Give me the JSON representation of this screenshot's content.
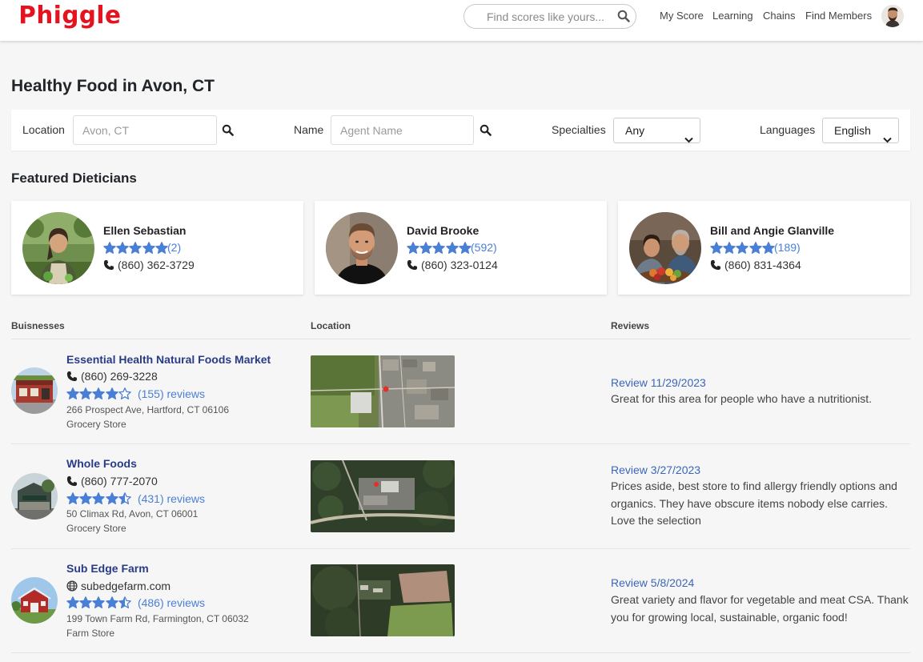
{
  "header": {
    "logo": "Phiggle",
    "search_placeholder": "Find scores like yours...",
    "nav": [
      "My Score",
      "Learning",
      "Chains",
      "Find Members"
    ]
  },
  "page_title": "Healthy Food in Avon, CT",
  "filters": {
    "location_label": "Location",
    "location_placeholder": "Avon, CT",
    "name_label": "Name",
    "name_placeholder": "Agent Name",
    "specialties_label": "Specialties",
    "specialties_value": "Any",
    "languages_label": "Languages",
    "languages_value": "English"
  },
  "featured_title": "Featured Dieticians",
  "featured": [
    {
      "name": "Ellen Sebastian",
      "rating": 5,
      "count": "(2)",
      "phone": "(860) 362-3729"
    },
    {
      "name": "David Brooke",
      "rating": 5,
      "count": "(592)",
      "phone": "(860) 323-0124"
    },
    {
      "name": "Bill and Angie Glanville",
      "rating": 5,
      "count": "(189)",
      "phone": "(860) 831-4364"
    }
  ],
  "table_headers": {
    "businesses": "Buisnesses",
    "location": "Location",
    "reviews": "Reviews"
  },
  "businesses": [
    {
      "name": "Essential Health Natural Foods Market",
      "contact_icon": "phone-icon",
      "contact": "(860) 269-3228",
      "rating": 4,
      "reviews": "(155) reviews",
      "address": "266 Prospect Ave, Hartford, CT 06106",
      "category": "Grocery Store",
      "review_date": "Review 11/29/2023",
      "review_text": "Great for this area for people who have a nutritionist."
    },
    {
      "name": "Whole Foods",
      "contact_icon": "phone-icon",
      "contact": "(860) 777-2070",
      "rating": 4.5,
      "reviews": "(431) reviews",
      "address": "50 Climax Rd, Avon, CT 06001",
      "category": "Grocery Store",
      "review_date": "Review 3/27/2023",
      "review_text": "Prices aside, best store to find allergy friendly options and organics. They have obscure items nobody else carries. Love the selection"
    },
    {
      "name": "Sub Edge Farm",
      "contact_icon": "globe-icon",
      "contact": "subedgefarm.com",
      "rating": 4.5,
      "reviews": "(486) reviews",
      "address": "199 Town Farm Rd, Farmington, CT 06032",
      "category": "Farm Store",
      "review_date": "Review 5/8/2024",
      "review_text": "Great variety and flavor for vegetable and meat CSA. Thank you for growing local, sustainable, organic food!"
    }
  ],
  "colors": {
    "brand_red": "#e5131f",
    "star_blue": "#4a7fd6",
    "link_navy": "#283c86",
    "review_link": "#3b66b8"
  }
}
